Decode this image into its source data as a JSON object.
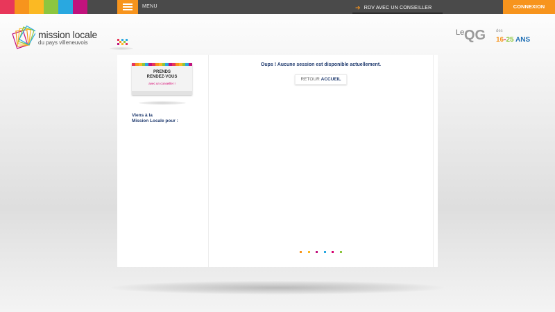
{
  "topbar": {
    "colors": [
      "#e8375a",
      "#f7941d",
      "#fbb923",
      "#8dc63f",
      "#29a8e0",
      "#c1127d"
    ],
    "menu_icon": "hamburger-icon",
    "menu_label": "MENU",
    "rdv_icon": "arrow-right-icon",
    "rdv_label": "RDV AVEC UN CONSEILLER",
    "login_label": "CONNEXION"
  },
  "header": {
    "logo_title": "mission locale",
    "logo_subtitle": "du pays villeneuvois",
    "qg_logo": {
      "le": "Le",
      "qg": "QG",
      "des": "des",
      "age_parts": [
        {
          "text": "16",
          "color": "#f7941d"
        },
        {
          "text": "-",
          "color": "#d6006f"
        },
        {
          "text": "25",
          "color": "#8dc63f"
        },
        {
          "text": " ANS",
          "color": "#1f6fb5"
        }
      ]
    }
  },
  "sidebar": {
    "card": {
      "line1": "PRENDS",
      "line2": "RENDEZ-VOUS",
      "line3": "avec un conseiller !"
    },
    "intro_line1": "Viens à la",
    "intro_line2": "Mission Locale pour :"
  },
  "main": {
    "message": "Oups ! Aucune session est disponible actuellement.",
    "back_button_prefix": "RETOUR",
    "back_button_bold": "ACCUEIL",
    "loader_colors": [
      "#f7941d",
      "#fbb923",
      "#c1127d",
      "#29a8e0",
      "#d6006f",
      "#8dc63f"
    ]
  }
}
